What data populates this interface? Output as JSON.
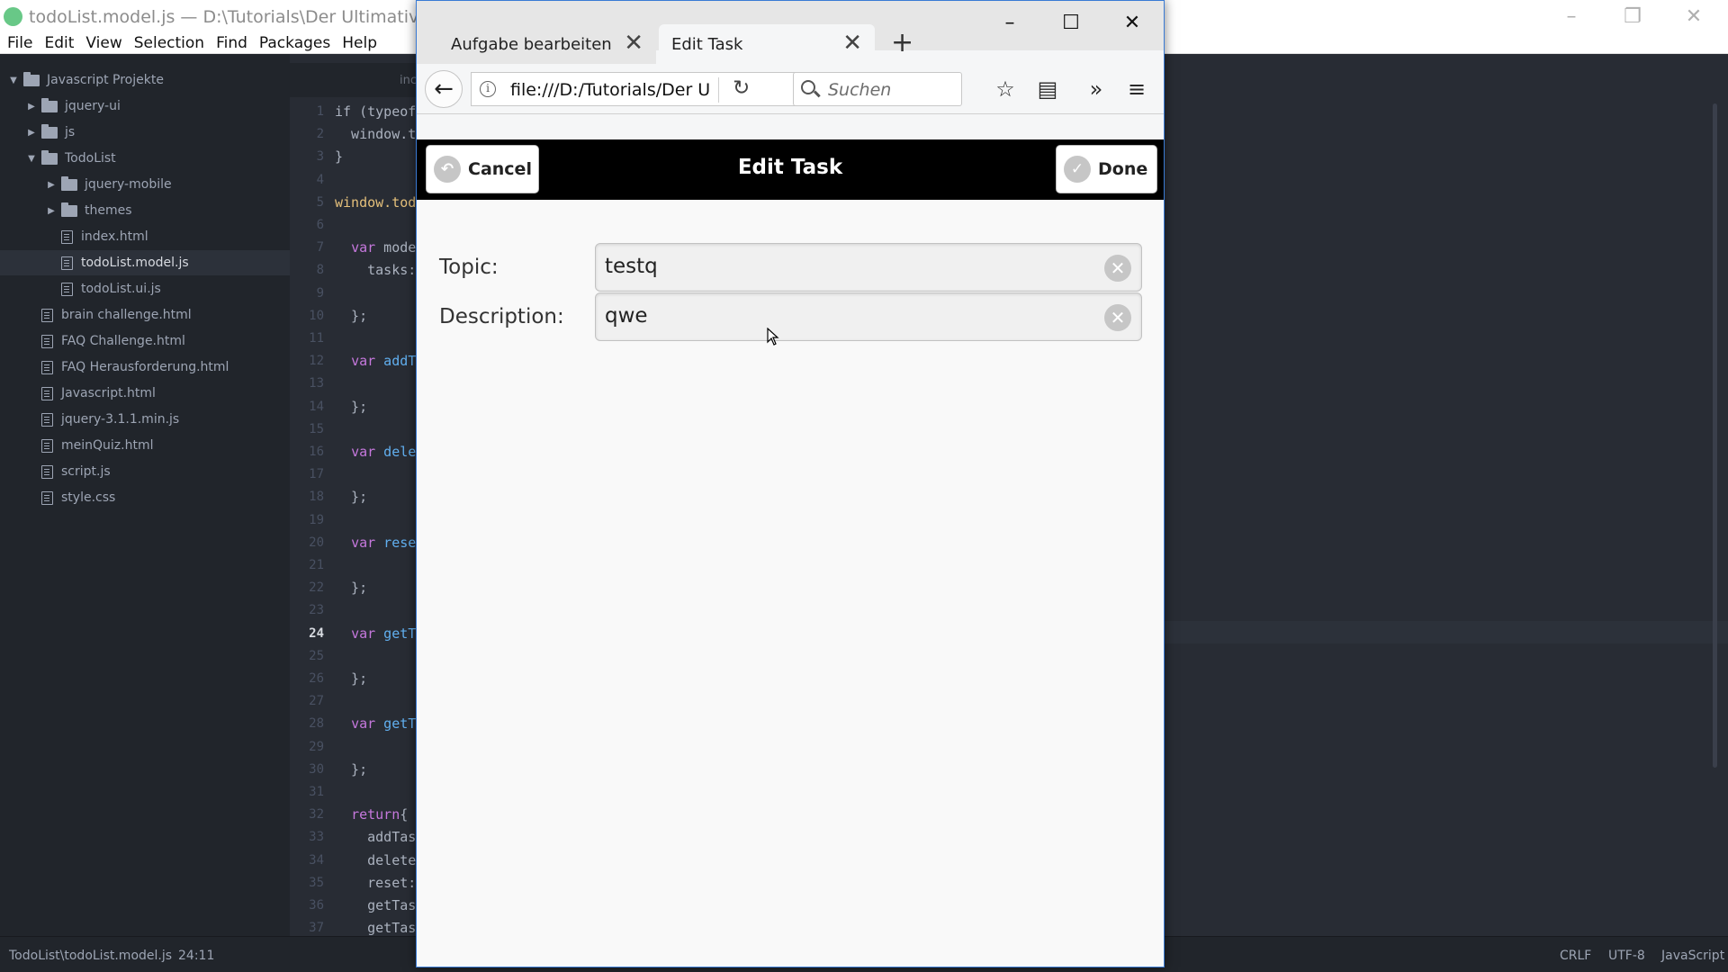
{
  "atom": {
    "window_title": "todoList.model.js — D:\\Tutorials\\Der Ultimative Javascr",
    "menu": [
      "File",
      "Edit",
      "View",
      "Selection",
      "Find",
      "Packages",
      "Help"
    ],
    "tab_hint": "inc",
    "tree": {
      "root": "Javascript Projekte",
      "items": [
        {
          "type": "folder",
          "label": "jquery-ui",
          "depth": 1,
          "expanded": false
        },
        {
          "type": "folder",
          "label": "js",
          "depth": 1,
          "expanded": false
        },
        {
          "type": "folder",
          "label": "TodoList",
          "depth": 1,
          "expanded": true
        },
        {
          "type": "folder",
          "label": "jquery-mobile",
          "depth": 2,
          "expanded": false
        },
        {
          "type": "folder",
          "label": "themes",
          "depth": 2,
          "expanded": false
        },
        {
          "type": "file",
          "label": "index.html",
          "depth": 2
        },
        {
          "type": "file",
          "label": "todoList.model.js",
          "depth": 2,
          "selected": true
        },
        {
          "type": "file",
          "label": "todoList.ui.js",
          "depth": 2
        },
        {
          "type": "file",
          "label": "brain challenge.html",
          "depth": 1
        },
        {
          "type": "file",
          "label": "FAQ Challenge.html",
          "depth": 1
        },
        {
          "type": "file",
          "label": "FAQ Herausforderung.html",
          "depth": 1
        },
        {
          "type": "file",
          "label": "Javascript.html",
          "depth": 1
        },
        {
          "type": "file",
          "label": "jquery-3.1.1.min.js",
          "depth": 1
        },
        {
          "type": "file",
          "label": "meinQuiz.html",
          "depth": 1
        },
        {
          "type": "file",
          "label": "script.js",
          "depth": 1
        },
        {
          "type": "file",
          "label": "style.css",
          "depth": 1
        }
      ]
    },
    "code_lines": [
      [
        {
          "t": "if (typeof"
        }
      ],
      [
        {
          "t": "  window.t"
        }
      ],
      [
        {
          "t": "}"
        }
      ],
      [
        {
          "t": ""
        }
      ],
      [
        {
          "t": "window.tod",
          "c": "var"
        }
      ],
      [
        {
          "t": ""
        }
      ],
      [
        {
          "t": "  "
        },
        {
          "t": "var",
          "c": "kw"
        },
        {
          "t": " mode"
        }
      ],
      [
        {
          "t": "    tasks:"
        }
      ],
      [
        {
          "t": ""
        }
      ],
      [
        {
          "t": "  };"
        }
      ],
      [
        {
          "t": ""
        }
      ],
      [
        {
          "t": "  "
        },
        {
          "t": "var",
          "c": "kw"
        },
        {
          "t": " addT",
          "c": "fn"
        }
      ],
      [
        {
          "t": ""
        }
      ],
      [
        {
          "t": "  };"
        }
      ],
      [
        {
          "t": ""
        }
      ],
      [
        {
          "t": "  "
        },
        {
          "t": "var",
          "c": "kw"
        },
        {
          "t": " dele",
          "c": "fn"
        }
      ],
      [
        {
          "t": ""
        }
      ],
      [
        {
          "t": "  };"
        }
      ],
      [
        {
          "t": ""
        }
      ],
      [
        {
          "t": "  "
        },
        {
          "t": "var",
          "c": "kw"
        },
        {
          "t": " rese",
          "c": "fn"
        }
      ],
      [
        {
          "t": ""
        }
      ],
      [
        {
          "t": "  };"
        }
      ],
      [
        {
          "t": ""
        }
      ],
      [
        {
          "t": "  "
        },
        {
          "t": "var",
          "c": "kw"
        },
        {
          "t": " getT",
          "c": "fn"
        }
      ],
      [
        {
          "t": ""
        }
      ],
      [
        {
          "t": "  };"
        }
      ],
      [
        {
          "t": ""
        }
      ],
      [
        {
          "t": "  "
        },
        {
          "t": "var",
          "c": "kw"
        },
        {
          "t": " getT",
          "c": "fn"
        }
      ],
      [
        {
          "t": ""
        }
      ],
      [
        {
          "t": "  };"
        }
      ],
      [
        {
          "t": ""
        }
      ],
      [
        {
          "t": "  "
        },
        {
          "t": "return",
          "c": "kw"
        },
        {
          "t": "{"
        }
      ],
      [
        {
          "t": "    addTas"
        }
      ],
      [
        {
          "t": "    delete"
        }
      ],
      [
        {
          "t": "    reset:"
        }
      ],
      [
        {
          "t": "    getTas"
        }
      ],
      [
        {
          "t": "    getTas"
        }
      ]
    ],
    "active_line": 24,
    "status": {
      "path": "TodoList\\todoList.model.js",
      "cursor": "24:11",
      "line_ending": "CRLF",
      "encoding": "UTF-8",
      "grammar": "JavaScript"
    }
  },
  "firefox": {
    "tabs": [
      {
        "label": "Aufgabe bearbeiten",
        "active": false
      },
      {
        "label": "Edit Task",
        "active": true
      }
    ],
    "url": "file:///D:/Tutorials/Der U",
    "search_placeholder": "Suchen",
    "page": {
      "header_title": "Edit Task",
      "cancel_label": "Cancel",
      "done_label": "Done",
      "fields": [
        {
          "label": "Topic:",
          "value": "testq"
        },
        {
          "label": "Description:",
          "value": "qwe"
        }
      ]
    }
  }
}
